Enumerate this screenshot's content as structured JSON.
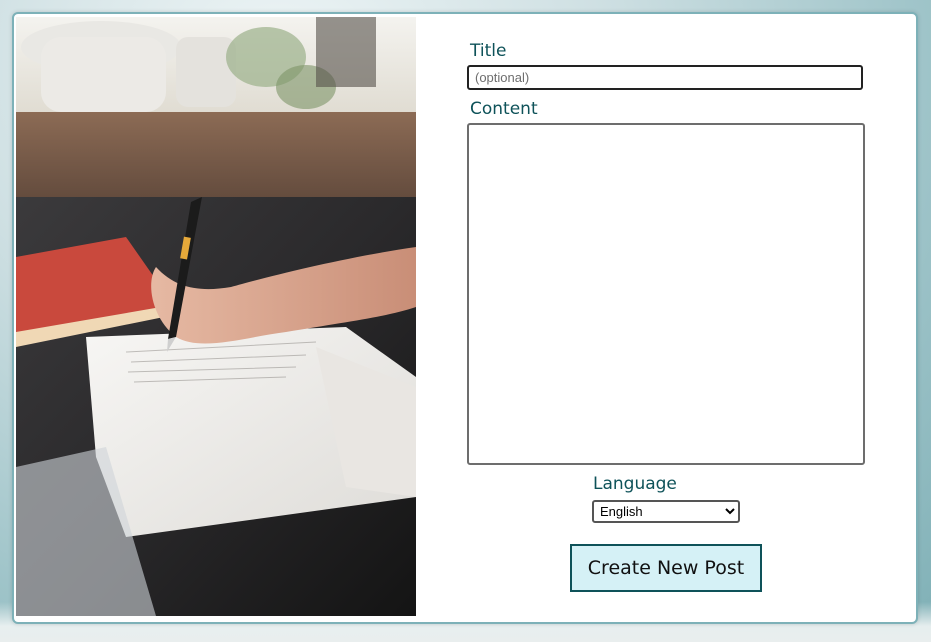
{
  "form": {
    "title_label": "Title",
    "title_placeholder": "(optional)",
    "title_value": "",
    "content_label": "Content",
    "content_value": "",
    "language_label": "Language",
    "language_selected": "English",
    "submit_label": "Create New Post"
  },
  "colors": {
    "label": "#0e5259",
    "button_bg": "#d5f1f6",
    "button_border": "#0e5259",
    "card_border": "#7db1b8"
  }
}
